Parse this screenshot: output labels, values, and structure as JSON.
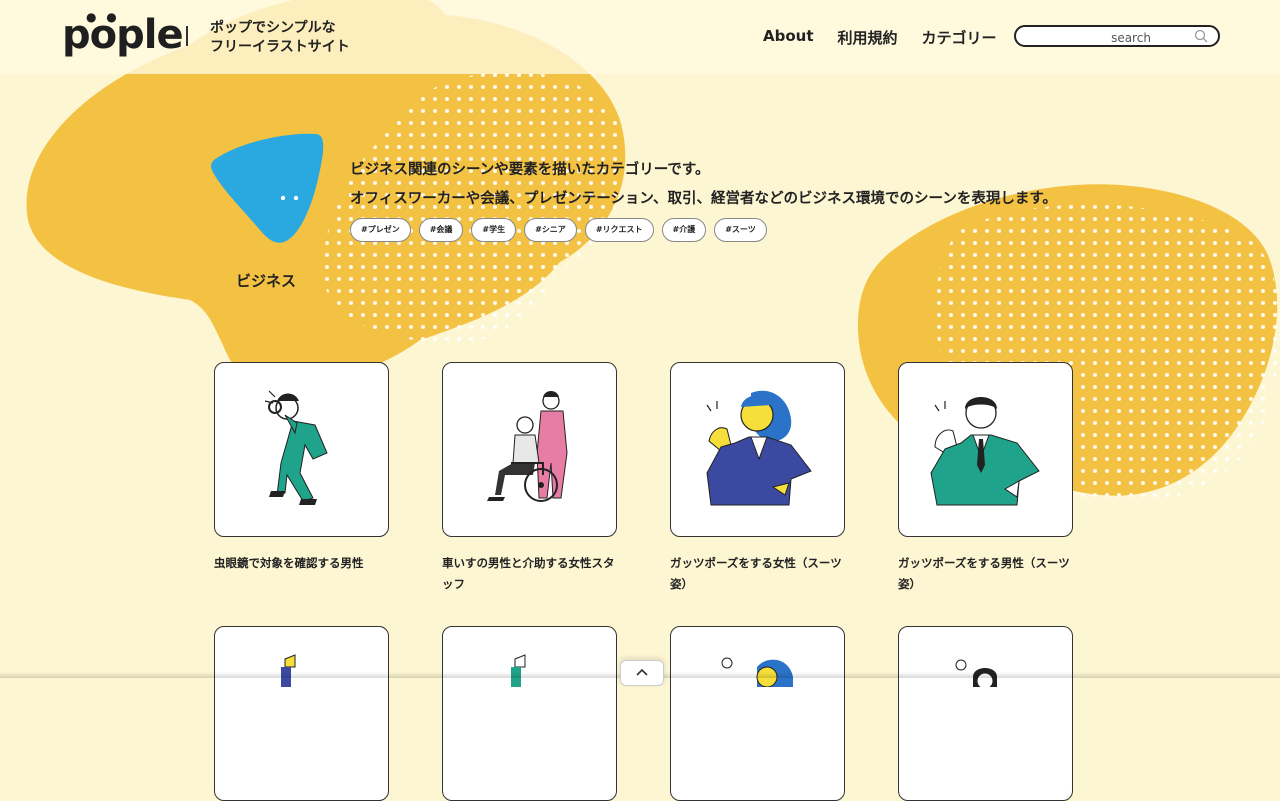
{
  "header": {
    "logo_text": "pople",
    "tagline_line1": "ポップでシンプルな",
    "tagline_line2": "フリーイラストサイト",
    "nav": [
      {
        "label": "About"
      },
      {
        "label": "利用規約"
      },
      {
        "label": "カテゴリー"
      }
    ],
    "search_placeholder": "search"
  },
  "category": {
    "name": "ビジネス",
    "description_line1": "ビジネス関連のシーンや要素を描いたカテゴリーです。",
    "description_line2": "オフィスワーカーや会議、プレゼンテーション、取引、経営者などのビジネス環境でのシーンを表現します。",
    "icon_color": "#2aa8e0",
    "tags": [
      "#プレゼン",
      "#会議",
      "#学生",
      "#シニア",
      "#リクエスト",
      "#介護",
      "#スーツ"
    ]
  },
  "cards": [
    {
      "title": "虫眼鏡で対象を確認する男性",
      "icon": "man-magnifier-illustration"
    },
    {
      "title": "車いすの男性と介助する女性スタッフ",
      "icon": "wheelchair-caregiver-illustration"
    },
    {
      "title": "ガッツポーズをする女性（スーツ姿）",
      "icon": "woman-guts-pose-illustration"
    },
    {
      "title": "ガッツポーズをする男性（スーツ姿）",
      "icon": "man-guts-pose-illustration"
    }
  ],
  "colors": {
    "background": "#fdf6d3",
    "blob": "#f4c242",
    "accent_blue": "#2aa8e0",
    "green_suit": "#1fa38a",
    "navy_suit": "#3b4aa0"
  }
}
